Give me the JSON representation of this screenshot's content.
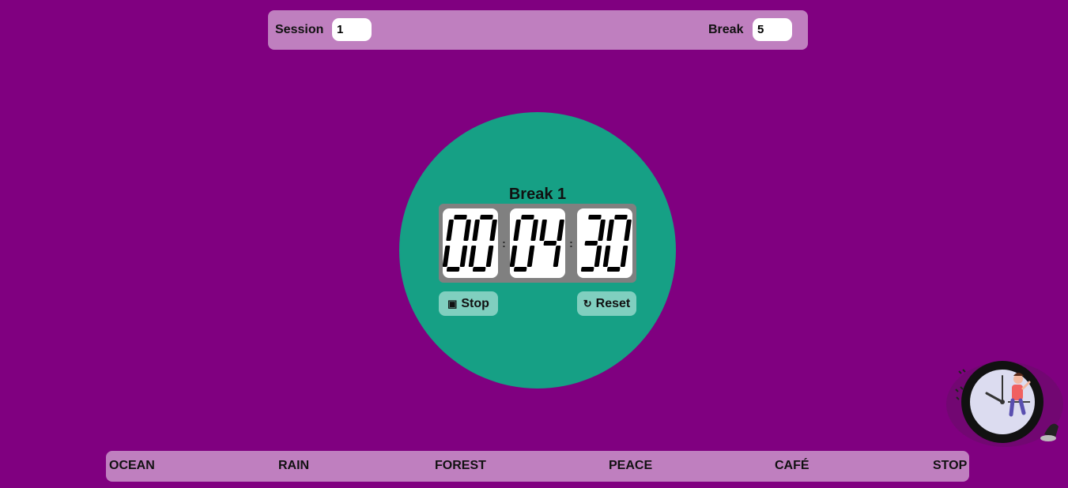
{
  "settings": {
    "session_label": "Session",
    "session_value": "1",
    "break_label": "Break",
    "break_value": "5"
  },
  "timer": {
    "title": "Break 1",
    "hours": "00",
    "minutes": "04",
    "seconds": "30",
    "separator": ":",
    "digit_color": "#000000",
    "stop_icon": "stop-square-icon",
    "stop_glyph": "▣",
    "stop_label": "Stop",
    "reset_icon": "reset-arrow-icon",
    "reset_glyph": "↻",
    "reset_label": "Reset"
  },
  "sounds": {
    "items": [
      "OCEAN",
      "RAIN",
      "FOREST",
      "PEACE",
      "CAFÉ",
      "STOP"
    ]
  },
  "colors": {
    "background": "#800080",
    "panel": "#bf7fbf",
    "circle": "#16a085",
    "button": "#80cfbf",
    "clock_frame": "#808080"
  }
}
